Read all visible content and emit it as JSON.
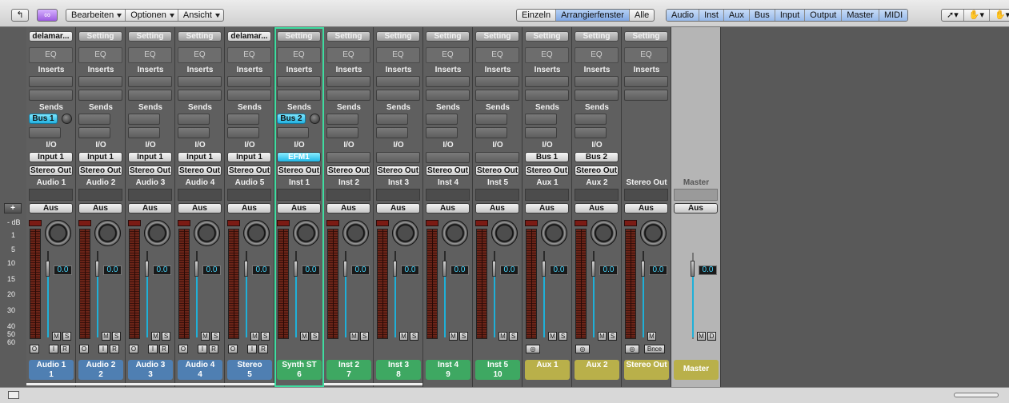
{
  "toolbar": {
    "menus": [
      "Bearbeiten",
      "Optionen",
      "Ansicht"
    ],
    "view_modes": [
      "Einzeln",
      "Arrangierfenster",
      "Alle"
    ],
    "active_view": "Arrangierfenster",
    "filters": [
      "Audio",
      "Inst",
      "Aux",
      "Bus",
      "Input",
      "Output",
      "Master",
      "MIDI"
    ]
  },
  "labels": {
    "setting": "Setting",
    "eq": "EQ",
    "inserts": "Inserts",
    "sends": "Sends",
    "io": "I/O",
    "aus": "Aus",
    "mute": "M",
    "solo": "S",
    "disk": "D",
    "o": "O",
    "i": "I",
    "r": "R",
    "bnce": "Bnce",
    "add": "+"
  },
  "scale": [
    "- dB",
    "1",
    "5",
    "10",
    "15",
    "20",
    "30",
    "40",
    "50",
    "60"
  ],
  "channels": [
    {
      "setting": "delamar...",
      "send": "Bus 1",
      "input": "Input 1",
      "output": "Stereo Out",
      "track": "Audio 1",
      "name": "Audio 1",
      "num": "1",
      "fader": "0.0",
      "color": "#4f7fb2",
      "type": "audio"
    },
    {
      "setting": "Setting",
      "send": "",
      "input": "Input 1",
      "output": "Stereo Out",
      "track": "Audio 2",
      "name": "Audio 2",
      "num": "2",
      "fader": "0.0",
      "color": "#4f7fb2",
      "type": "audio"
    },
    {
      "setting": "Setting",
      "send": "",
      "input": "Input 1",
      "output": "Stereo Out",
      "track": "Audio 3",
      "name": "Audio 3",
      "num": "3",
      "fader": "0.0",
      "color": "#4f7fb2",
      "type": "audio"
    },
    {
      "setting": "Setting",
      "send": "",
      "input": "Input 1",
      "output": "Stereo Out",
      "track": "Audio 4",
      "name": "Audio 4",
      "num": "4",
      "fader": "0.0",
      "color": "#4f7fb2",
      "type": "audio"
    },
    {
      "setting": "delamar...",
      "send": "",
      "input": "Input 1",
      "output": "Stereo Out",
      "track": "Audio 5",
      "name": "Stereo",
      "num": "5",
      "fader": "0.0",
      "color": "#4f7fb2",
      "type": "audio"
    },
    {
      "setting": "Setting",
      "send": "Bus 2",
      "input": "EFM1",
      "output": "Stereo Out",
      "track": "Inst 1",
      "name": "Synth ST",
      "num": "6",
      "fader": "0.0",
      "color": "#3ea862",
      "type": "inst"
    },
    {
      "setting": "Setting",
      "send": "",
      "input": "",
      "output": "Stereo Out",
      "track": "Inst 2",
      "name": "Inst 2",
      "num": "7",
      "fader": "0.0",
      "color": "#3ea862",
      "type": "inst"
    },
    {
      "setting": "Setting",
      "send": "",
      "input": "",
      "output": "Stereo Out",
      "track": "Inst 3",
      "name": "Inst 3",
      "num": "8",
      "fader": "0.0",
      "color": "#3ea862",
      "type": "inst"
    },
    {
      "setting": "Setting",
      "send": "",
      "input": "",
      "output": "Stereo Out",
      "track": "Inst 4",
      "name": "Inst 4",
      "num": "9",
      "fader": "0.0",
      "color": "#3ea862",
      "type": "inst"
    },
    {
      "setting": "Setting",
      "send": "",
      "input": "",
      "output": "Stereo Out",
      "track": "Inst 5",
      "name": "Inst 5",
      "num": "10",
      "fader": "0.0",
      "color": "#3ea862",
      "type": "inst"
    },
    {
      "setting": "Setting",
      "send": "",
      "input": "Bus 1",
      "output": "Stereo Out",
      "track": "Aux 1",
      "name": "Aux 1",
      "num": "",
      "fader": "0.0",
      "color": "#b9b04a",
      "type": "aux"
    },
    {
      "setting": "Setting",
      "send": "",
      "input": "Bus 2",
      "output": "Stereo Out",
      "track": "Aux 2",
      "name": "Aux 2",
      "num": "",
      "fader": "0.0",
      "color": "#b9b04a",
      "type": "aux"
    },
    {
      "setting": "Setting",
      "send": "",
      "input": "",
      "output": "",
      "track": "Stereo Out",
      "name": "Stereo Out",
      "num": "",
      "fader": "0.0",
      "color": "#b9b04a",
      "type": "out"
    }
  ],
  "master": {
    "track": "Master",
    "aus": "Aus",
    "fader": "0.0",
    "name": "Master",
    "color": "#b9b04a"
  }
}
